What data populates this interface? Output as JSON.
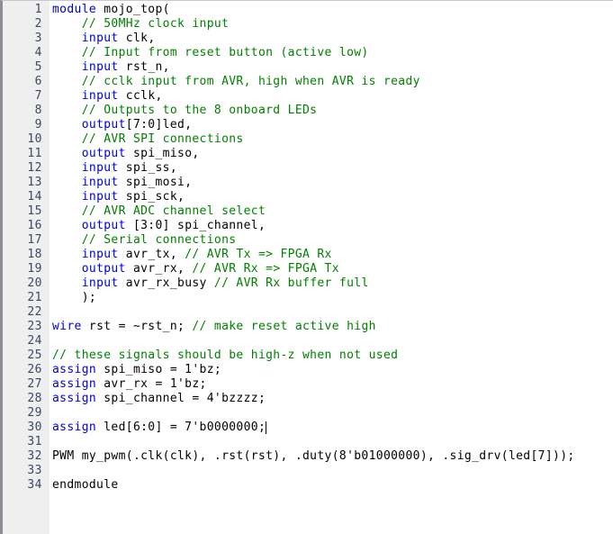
{
  "editor": {
    "language": "Verilog",
    "font_size_px": 13,
    "line_height_px": 16,
    "first_line_number": 1,
    "last_line_number": 34,
    "colors": {
      "background": "#ffffff",
      "gutter_background": "#efefef",
      "gutter_border": "#8a8f96",
      "line_number_text": "#3b4a63",
      "keyword": "#0000cd",
      "comment": "#008000",
      "plain_text": "#000000",
      "caret": "#000000"
    },
    "caret": {
      "line": 30,
      "column_after_text": "assign led[6:0] = 7'b0000000;"
    }
  },
  "gutter": {
    "line_numbers": [
      "1",
      "2",
      "3",
      "4",
      "5",
      "6",
      "7",
      "8",
      "9",
      "10",
      "11",
      "12",
      "13",
      "14",
      "15",
      "16",
      "17",
      "18",
      "19",
      "20",
      "21",
      "22",
      "23",
      "24",
      "25",
      "26",
      "27",
      "28",
      "29",
      "30",
      "31",
      "32",
      "33",
      "34"
    ]
  },
  "code": {
    "lines": [
      {
        "n": 1,
        "tokens": [
          {
            "t": "keyword",
            "v": "module"
          },
          {
            "t": "plain",
            "v": " mojo_top("
          }
        ]
      },
      {
        "n": 2,
        "tokens": [
          {
            "t": "comment",
            "v": "    // 50MHz clock input"
          }
        ]
      },
      {
        "n": 3,
        "tokens": [
          {
            "t": "plain",
            "v": "    "
          },
          {
            "t": "keyword",
            "v": "input"
          },
          {
            "t": "plain",
            "v": " clk,"
          }
        ]
      },
      {
        "n": 4,
        "tokens": [
          {
            "t": "comment",
            "v": "    // Input from reset button (active low)"
          }
        ]
      },
      {
        "n": 5,
        "tokens": [
          {
            "t": "plain",
            "v": "    "
          },
          {
            "t": "keyword",
            "v": "input"
          },
          {
            "t": "plain",
            "v": " rst_n,"
          }
        ]
      },
      {
        "n": 6,
        "tokens": [
          {
            "t": "comment",
            "v": "    // cclk input from AVR, high when AVR is ready"
          }
        ]
      },
      {
        "n": 7,
        "tokens": [
          {
            "t": "plain",
            "v": "    "
          },
          {
            "t": "keyword",
            "v": "input"
          },
          {
            "t": "plain",
            "v": " cclk,"
          }
        ]
      },
      {
        "n": 8,
        "tokens": [
          {
            "t": "comment",
            "v": "    // Outputs to the 8 onboard LEDs"
          }
        ]
      },
      {
        "n": 9,
        "tokens": [
          {
            "t": "plain",
            "v": "    "
          },
          {
            "t": "keyword",
            "v": "output"
          },
          {
            "t": "plain",
            "v": "[7:0]led,"
          }
        ]
      },
      {
        "n": 10,
        "tokens": [
          {
            "t": "comment",
            "v": "    // AVR SPI connections"
          }
        ]
      },
      {
        "n": 11,
        "tokens": [
          {
            "t": "plain",
            "v": "    "
          },
          {
            "t": "keyword",
            "v": "output"
          },
          {
            "t": "plain",
            "v": " spi_miso,"
          }
        ]
      },
      {
        "n": 12,
        "tokens": [
          {
            "t": "plain",
            "v": "    "
          },
          {
            "t": "keyword",
            "v": "input"
          },
          {
            "t": "plain",
            "v": " spi_ss,"
          }
        ]
      },
      {
        "n": 13,
        "tokens": [
          {
            "t": "plain",
            "v": "    "
          },
          {
            "t": "keyword",
            "v": "input"
          },
          {
            "t": "plain",
            "v": " spi_mosi,"
          }
        ]
      },
      {
        "n": 14,
        "tokens": [
          {
            "t": "plain",
            "v": "    "
          },
          {
            "t": "keyword",
            "v": "input"
          },
          {
            "t": "plain",
            "v": " spi_sck,"
          }
        ]
      },
      {
        "n": 15,
        "tokens": [
          {
            "t": "comment",
            "v": "    // AVR ADC channel select"
          }
        ]
      },
      {
        "n": 16,
        "tokens": [
          {
            "t": "plain",
            "v": "    "
          },
          {
            "t": "keyword",
            "v": "output"
          },
          {
            "t": "plain",
            "v": " [3:0] spi_channel,"
          }
        ]
      },
      {
        "n": 17,
        "tokens": [
          {
            "t": "comment",
            "v": "    // Serial connections"
          }
        ]
      },
      {
        "n": 18,
        "tokens": [
          {
            "t": "plain",
            "v": "    "
          },
          {
            "t": "keyword",
            "v": "input"
          },
          {
            "t": "plain",
            "v": " avr_tx, "
          },
          {
            "t": "comment",
            "v": "// AVR Tx => FPGA Rx"
          }
        ]
      },
      {
        "n": 19,
        "tokens": [
          {
            "t": "plain",
            "v": "    "
          },
          {
            "t": "keyword",
            "v": "output"
          },
          {
            "t": "plain",
            "v": " avr_rx, "
          },
          {
            "t": "comment",
            "v": "// AVR Rx => FPGA Tx"
          }
        ]
      },
      {
        "n": 20,
        "tokens": [
          {
            "t": "plain",
            "v": "    "
          },
          {
            "t": "keyword",
            "v": "input"
          },
          {
            "t": "plain",
            "v": " avr_rx_busy "
          },
          {
            "t": "comment",
            "v": "// AVR Rx buffer full"
          }
        ]
      },
      {
        "n": 21,
        "tokens": [
          {
            "t": "plain",
            "v": "    );"
          }
        ]
      },
      {
        "n": 22,
        "tokens": []
      },
      {
        "n": 23,
        "tokens": [
          {
            "t": "keyword",
            "v": "wire"
          },
          {
            "t": "plain",
            "v": " rst = ~rst_n; "
          },
          {
            "t": "comment",
            "v": "// make reset active high"
          }
        ]
      },
      {
        "n": 24,
        "tokens": []
      },
      {
        "n": 25,
        "tokens": [
          {
            "t": "comment",
            "v": "// these signals should be high-z when not used"
          }
        ]
      },
      {
        "n": 26,
        "tokens": [
          {
            "t": "keyword",
            "v": "assign"
          },
          {
            "t": "plain",
            "v": " spi_miso = 1'bz;"
          }
        ]
      },
      {
        "n": 27,
        "tokens": [
          {
            "t": "keyword",
            "v": "assign"
          },
          {
            "t": "plain",
            "v": " avr_rx = 1'bz;"
          }
        ]
      },
      {
        "n": 28,
        "tokens": [
          {
            "t": "keyword",
            "v": "assign"
          },
          {
            "t": "plain",
            "v": " spi_channel = 4'bzzzz;"
          }
        ]
      },
      {
        "n": 29,
        "tokens": []
      },
      {
        "n": 30,
        "tokens": [
          {
            "t": "keyword",
            "v": "assign"
          },
          {
            "t": "plain",
            "v": " led[6:0] = 7'b0000000;"
          }
        ]
      },
      {
        "n": 31,
        "tokens": []
      },
      {
        "n": 32,
        "tokens": [
          {
            "t": "plain",
            "v": "PWM my_pwm(.clk(clk), .rst(rst), .duty(8'b01000000), .sig_drv(led[7]));"
          }
        ]
      },
      {
        "n": 33,
        "tokens": []
      },
      {
        "n": 34,
        "tokens": [
          {
            "t": "plain",
            "v": "endmodule"
          }
        ]
      }
    ]
  }
}
